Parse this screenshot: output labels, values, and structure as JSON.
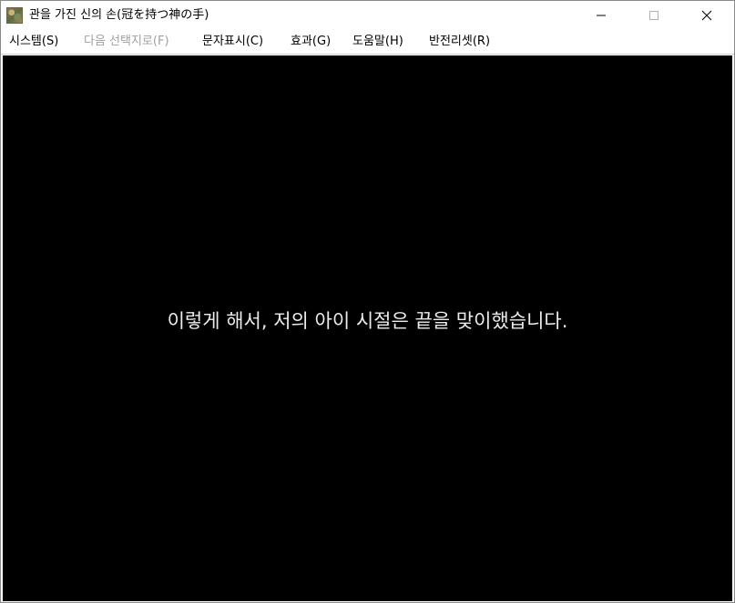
{
  "window": {
    "title": "관을 가진 신의 손(冠を持つ神の手)",
    "icon": "game-app-icon"
  },
  "controls": {
    "minimize_icon": "minimize-icon",
    "maximize_icon": "maximize-icon",
    "close_icon": "close-icon"
  },
  "menu": {
    "items": [
      {
        "label": "시스템(S)",
        "enabled": true
      },
      {
        "label": "다음 선택지로(F)",
        "enabled": false
      },
      {
        "label": "문자표시(C)",
        "enabled": true
      },
      {
        "label": "효과(G)",
        "enabled": true
      },
      {
        "label": "도움말(H)",
        "enabled": true
      },
      {
        "label": "반전리셋(R)",
        "enabled": true
      }
    ]
  },
  "screen": {
    "message": "이렇게 해서, 저의 아이 시절은 끝을 맞이했습니다.",
    "background": "#000000",
    "text_color": "#ececec"
  }
}
